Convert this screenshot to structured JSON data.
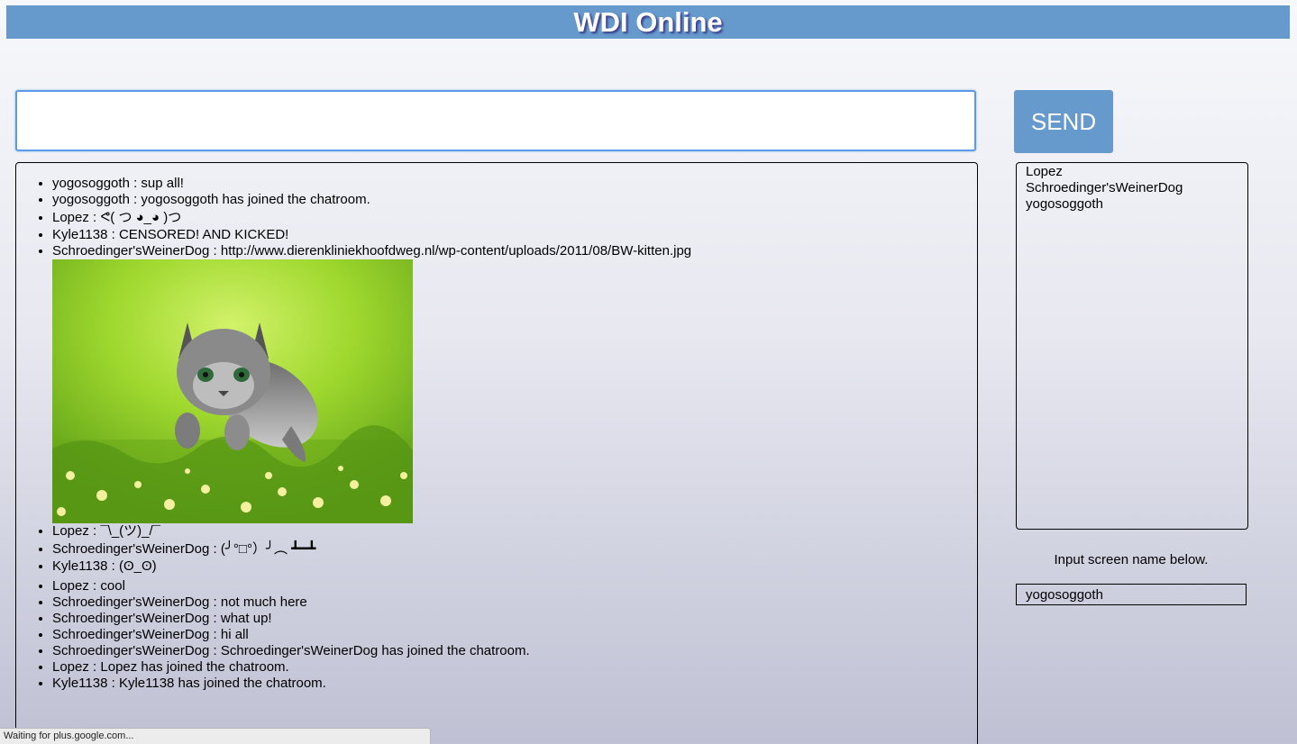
{
  "header": {
    "title": "WDI Online"
  },
  "composer": {
    "message_value": "",
    "send_label": "SEND"
  },
  "messages": [
    {
      "user": "yogosoggoth",
      "text": "sup all!"
    },
    {
      "user": "yogosoggoth",
      "text": "yogosoggoth has joined the chatroom."
    },
    {
      "user": "Lopez",
      "text": "ᕙ( つ ◕_◕ )つ"
    },
    {
      "user": "Kyle1138",
      "text": "CENSORED! AND KICKED!"
    },
    {
      "user": "Schroedinger'sWeinerDog",
      "text": "http://www.dierenkliniekhoofdweg.nl/wp-content/uploads/2011/08/BW-kitten.jpg"
    },
    {
      "user": "Lopez",
      "text": "¯\\_(ツ)_/¯"
    },
    {
      "user": "Schroedinger'sWeinerDog",
      "text": "(╯°□°）╯︵ ┻━┻"
    },
    {
      "user": "Kyle1138",
      "text": "(ʘ_ʘ)"
    },
    {
      "user": "Lopez",
      "text": "cool"
    },
    {
      "user": "Schroedinger'sWeinerDog",
      "text": "not much here"
    },
    {
      "user": "Schroedinger'sWeinerDog",
      "text": "what up!"
    },
    {
      "user": "Schroedinger'sWeinerDog",
      "text": "hi all"
    },
    {
      "user": "Schroedinger'sWeinerDog",
      "text": "Schroedinger'sWeinerDog has joined the chatroom."
    },
    {
      "user": "Lopez",
      "text": "Lopez has joined the chatroom."
    },
    {
      "user": "Kyle1138",
      "text": "Kyle1138 has joined the chatroom."
    }
  ],
  "separator": " : ",
  "users": [
    "Lopez",
    "Schroedinger'sWeinerDog",
    "yogosoggoth"
  ],
  "screen_name": {
    "label": "Input screen name below.",
    "value": "yogosoggoth"
  },
  "status_bar": {
    "text": "Waiting for plus.google.com..."
  },
  "colors": {
    "header_bg": "#6699cc",
    "button_bg": "#6699cc",
    "title_text": "#ffffff"
  },
  "icons": {
    "bullet": "disc"
  }
}
